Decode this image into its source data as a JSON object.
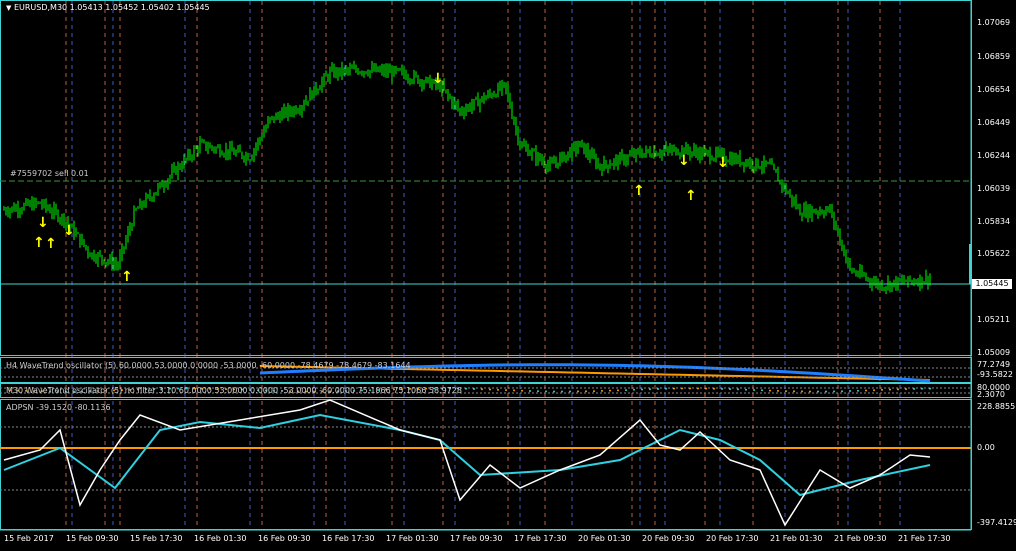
{
  "main": {
    "title": "EURUSD,M30  1.05413 1.05452 1.05402 1.05445",
    "order_label": "#7559702 sell 0.01",
    "price_ticks": [
      "1.07069",
      "1.06859",
      "1.06654",
      "1.06449",
      "1.06244",
      "1.06039",
      "1.05834",
      "1.05622",
      "1.05211",
      "1.05009"
    ],
    "current_price": "1.05445"
  },
  "indicator1": {
    "label": "H4 WaveTrend oscillator (5) 60.0000 53.0000 0.0000 -53.0000 -60.0000 -78.4679 -78.4679 -83.1644",
    "ticks": [
      "77.2749",
      "-93.5822"
    ]
  },
  "indicator2": {
    "label": "M30 WaveTrend oscillator (5) no filter 3.10 60.0000 53.0000 0.0000 -53.0000 -60.0000 75.1066 75.1066 58.9728",
    "ticks": [
      "80.0000",
      "2.3070"
    ]
  },
  "indicator3": {
    "label": "ADPSN -39.1520 -80.1136",
    "ticks": [
      "228.8855",
      "0.00",
      "-397.4129"
    ]
  },
  "time_labels": [
    "15 Feb 2017",
    "15 Feb 09:30",
    "15 Feb 17:30",
    "16 Feb 01:30",
    "16 Feb 09:30",
    "16 Feb 17:30",
    "17 Feb 01:30",
    "17 Feb 09:30",
    "17 Feb 17:30",
    "20 Feb 01:30",
    "20 Feb 09:30",
    "20 Feb 17:30",
    "21 Feb 01:30",
    "21 Feb 09:30",
    "21 Feb 17:30"
  ],
  "chart_data": {
    "type": "line",
    "title": "EURUSD,M30",
    "x": [
      "15 Feb 2017",
      "15 Feb 09:30",
      "15 Feb 17:30",
      "16 Feb 01:30",
      "16 Feb 09:30",
      "16 Feb 17:30",
      "17 Feb 01:30",
      "17 Feb 09:30",
      "17 Feb 17:30",
      "20 Feb 01:30",
      "20 Feb 09:30",
      "20 Feb 17:30",
      "21 Feb 01:30",
      "21 Feb 09:30",
      "21 Feb 17:30"
    ],
    "series": [
      {
        "name": "EURUSD,M30",
        "values": [
          1.0585,
          1.0557,
          1.0598,
          1.0625,
          1.0645,
          1.0668,
          1.066,
          1.0648,
          1.0615,
          1.0615,
          1.062,
          1.0612,
          1.059,
          1.0545,
          1.0545
        ],
        "color": "#00ff00"
      }
    ],
    "ylim": [
      1.05009,
      1.07069
    ],
    "current_price": 1.05445,
    "order_line": 1.0609,
    "grid": false,
    "colors": {
      "background": "#000000",
      "axis": "#3fd3d3",
      "arrow": "#ffff00",
      "cyan": "#2fd0e0",
      "orange": "#ff9900"
    }
  }
}
